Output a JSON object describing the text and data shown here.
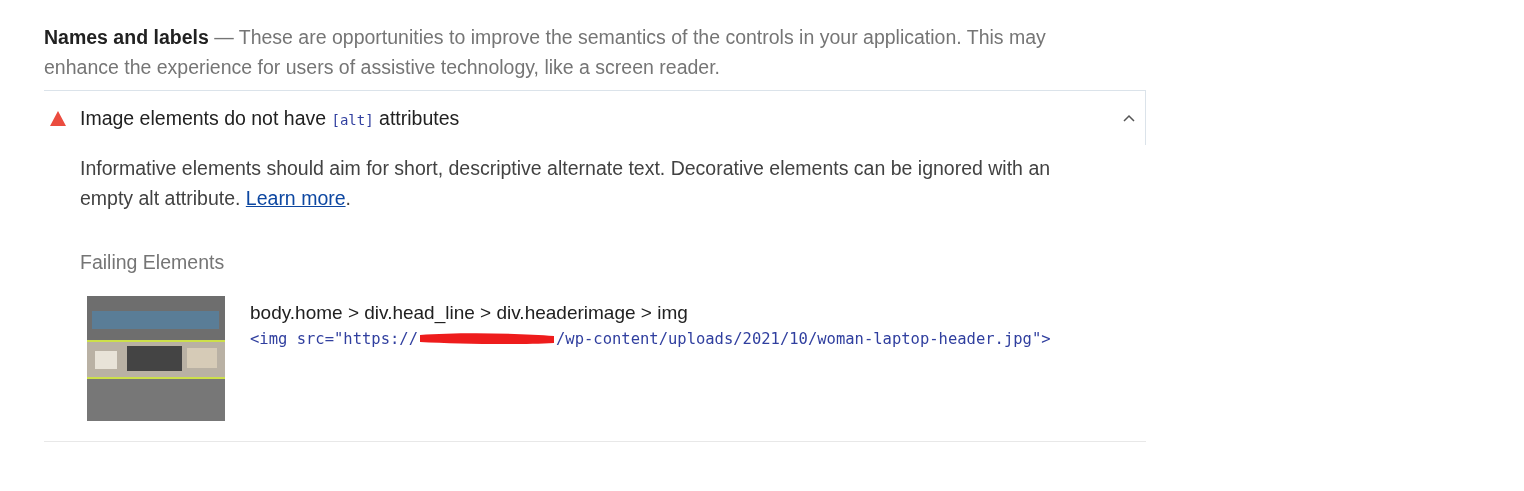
{
  "group": {
    "title": "Names and labels",
    "description": "— These are opportunities to improve the semantics of the controls in your application. This may enhance the experience for users of assistive technology, like a screen reader."
  },
  "audit": {
    "failed": true,
    "title_before": "Image elements do not have",
    "code": "[alt]",
    "title_after": "attributes",
    "expanded": true,
    "description": "Informative elements should aim for short, descriptive alternate text. Decorative elements can be ignored with an empty alt attribute.",
    "link": "Learn more",
    "link_after": ".",
    "failing_title": "Failing Elements",
    "items": [
      {
        "selector": "body.home > div.head_line > div.headerimage > img",
        "snippet_before": "<img src=\"https://",
        "redacted": true,
        "snippet_after": "/wp-content/uploads/2021/10/woman-laptop-header.jpg\">"
      }
    ]
  }
}
